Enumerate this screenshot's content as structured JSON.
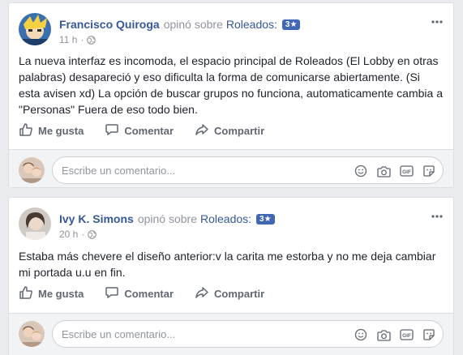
{
  "posts": [
    {
      "author": "Francisco Quiroga",
      "verb": "opinó sobre",
      "group": "Roleados:",
      "badge": "3★",
      "time": "11 h",
      "dot": "·",
      "text": "La nueva interfaz es incomoda, el espacio principal de Roleados (El Lobby en otras palabras) desapareció y eso dificulta la forma de comunicarse abiertamente. (Si esta avisen xd) La opción de buscar grupos no funciona, automaticamente cambia a \"Personas\" Fuera de eso todo bien."
    },
    {
      "author": "Ivy K. Simons",
      "verb": "opinó sobre",
      "group": "Roleados:",
      "badge": "3★",
      "time": "20 h",
      "dot": "·",
      "text": "Estaba más chevere el diseño anterior:v la carita me estorba y no me deja cambiar mi portada u.u en fin."
    }
  ],
  "actions": {
    "like": "Me gusta",
    "comment": "Comentar",
    "share": "Compartir"
  },
  "comment_box": {
    "placeholder": "Escribe un comentario...",
    "gif_label": "GIF"
  },
  "colors": {
    "link": "#365899",
    "badge": "#4267b2",
    "muted": "#90949c",
    "background": "#e9ebee"
  },
  "icons": [
    "globe-icon",
    "more-options-icon",
    "like-icon",
    "comment-icon",
    "share-icon",
    "emoji-icon",
    "camera-icon",
    "gif-icon",
    "sticker-icon"
  ]
}
